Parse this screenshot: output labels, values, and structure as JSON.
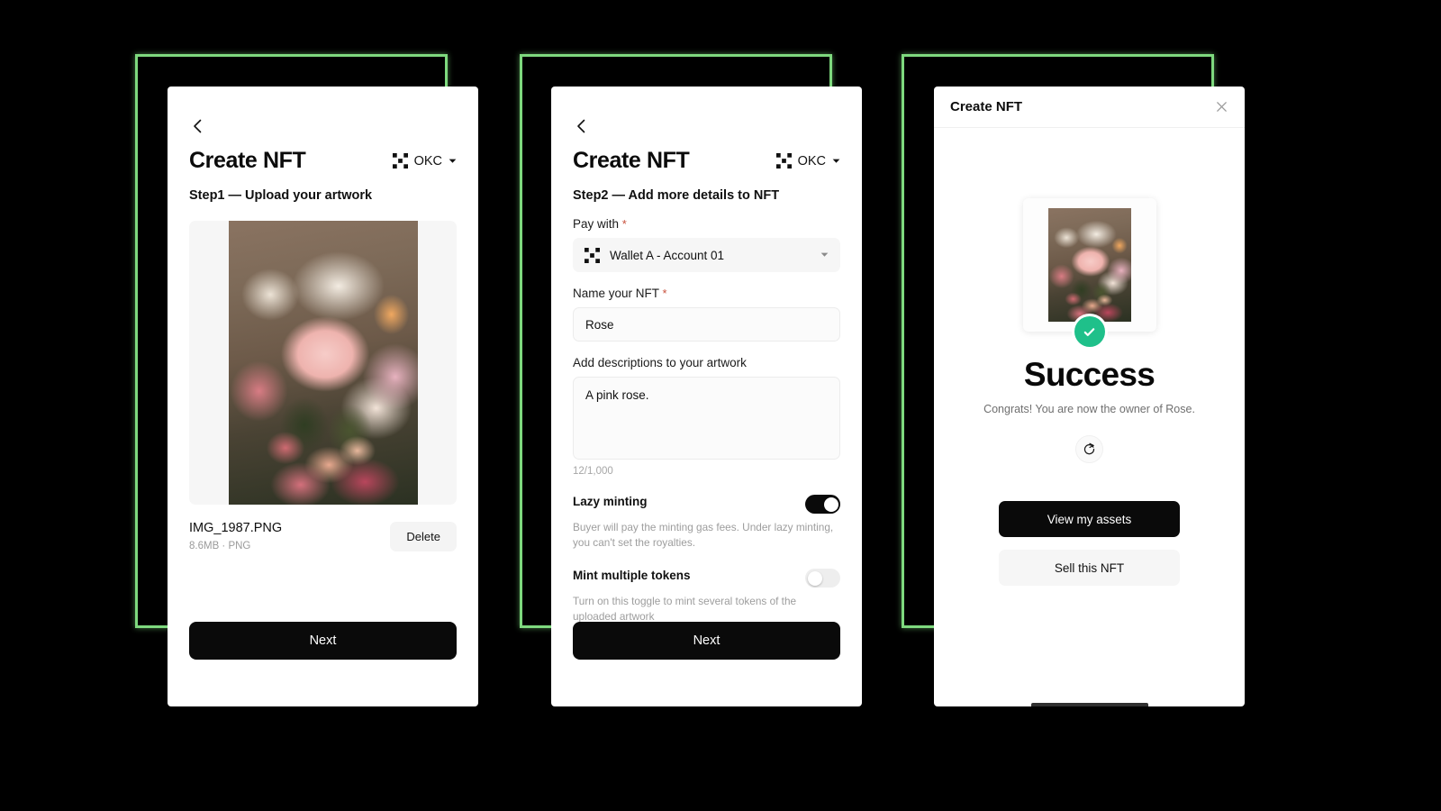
{
  "meta": {
    "background_color": "#000000",
    "accent_green": "#7ed97e",
    "success_green": "#1fc08a",
    "required_red": "#c8503c"
  },
  "screens": [
    {
      "id": "step1",
      "back_icon": "chevron-left-icon",
      "title": "Create NFT",
      "chain": {
        "icon": "okc-logo-icon",
        "label": "OKC",
        "caret": "chevron-down-icon"
      },
      "step_heading": "Step1 — Upload your artwork",
      "artwork": {
        "alt": "pink-rose-bouquet-photo"
      },
      "file": {
        "name": "IMG_1987.PNG",
        "meta": "8.6MB · PNG",
        "delete_label": "Delete"
      },
      "primary_label": "Next"
    },
    {
      "id": "step2",
      "back_icon": "chevron-left-icon",
      "title": "Create NFT",
      "chain": {
        "icon": "okc-logo-icon",
        "label": "OKC",
        "caret": "chevron-down-icon"
      },
      "step_heading": "Step2 — Add more details to NFT",
      "pay_with": {
        "label": "Pay with",
        "required": "*",
        "icon": "okc-logo-icon",
        "value": "Wallet A - Account 01",
        "caret": "chevron-down-icon"
      },
      "name_field": {
        "label": "Name your NFT",
        "required": "*",
        "value": "Rose",
        "placeholder": "Name your NFT"
      },
      "description_field": {
        "label": "Add descriptions to your artwork",
        "value": "A pink rose.",
        "placeholder": "Add descriptions to your artwork",
        "counter": "12/1,000"
      },
      "toggles": [
        {
          "title": "Lazy minting",
          "description": "Buyer will pay the minting gas fees. Under lazy minting, you can't set the royalties.",
          "state": "on"
        },
        {
          "title": "Mint multiple tokens",
          "description": "Turn on this toggle to mint several tokens of the uploaded artwork",
          "state": "off"
        }
      ],
      "primary_label": "Next"
    },
    {
      "id": "success",
      "modal_title": "Create NFT",
      "close_icon": "close-icon",
      "thumbnail": {
        "alt": "pink-rose-bouquet-photo"
      },
      "badge_icon": "check-circle-icon",
      "success_title": "Success",
      "success_subtitle": "Congrats! You are now the owner of Rose.",
      "share_icon": "share-icon",
      "primary_label": "View my assets",
      "secondary_label": "Sell this NFT"
    }
  ]
}
